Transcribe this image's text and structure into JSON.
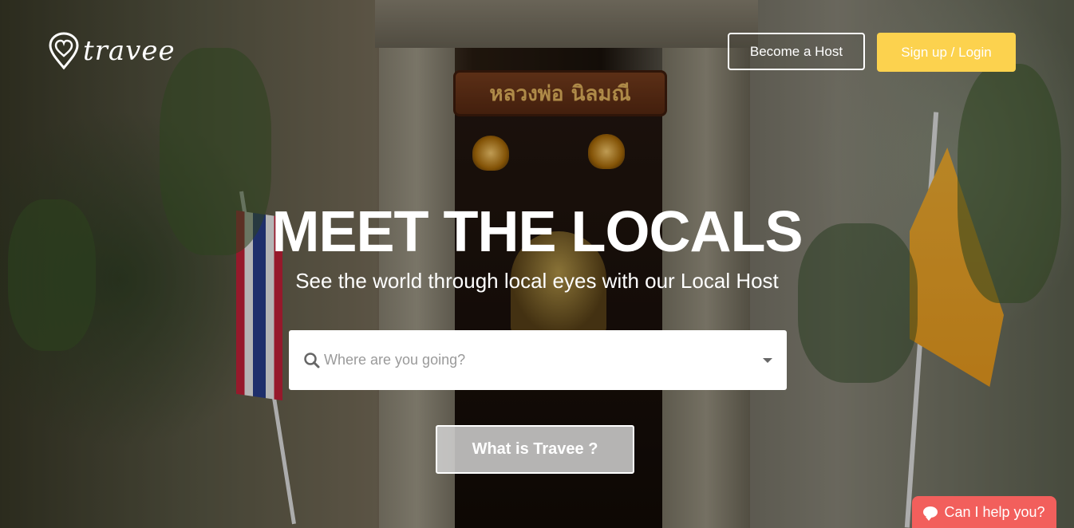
{
  "brand": {
    "name": "travee",
    "logo_icon": "location-heart-icon"
  },
  "header": {
    "become_host_label": "Become a Host",
    "signup_login_label": "Sign up / Login",
    "accent_color": "#fcd24e"
  },
  "hero": {
    "title": "MEET THE LOCALS",
    "subtitle": "See the world through local eyes with our Local Host",
    "sign_text": "หลวงพ่อ นิลมณี"
  },
  "search": {
    "placeholder": "Where are you going?",
    "icon": "search-icon",
    "dropdown_icon": "caret-down-icon"
  },
  "cta": {
    "what_is_label": "What is Travee ?"
  },
  "chat": {
    "label": "Can I help you?",
    "icon": "chat-bubble-icon",
    "color": "#f25f5c"
  }
}
